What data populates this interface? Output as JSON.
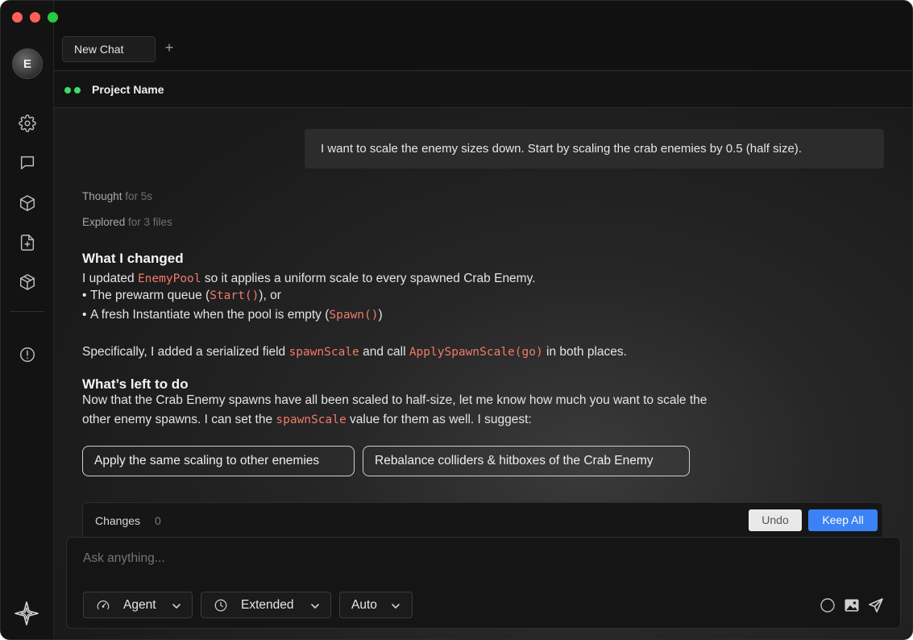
{
  "window": {
    "traffic_lights": [
      "close",
      "minimize",
      "maximize"
    ]
  },
  "sidebar": {
    "avatar_initial": "E",
    "items": [
      {
        "icon": "gear-icon"
      },
      {
        "icon": "chat-bubble-icon"
      },
      {
        "icon": "cube-icon"
      },
      {
        "icon": "file-plus-icon"
      },
      {
        "icon": "package-icon"
      },
      {
        "icon": "alert-circle-icon"
      }
    ],
    "logo_icon": "sparkle-star-icon"
  },
  "tabs": {
    "items": [
      {
        "label": "New Chat"
      }
    ],
    "add_label": "+"
  },
  "project": {
    "name": "Project Name",
    "status_color": "#3ddc6a"
  },
  "conversation": {
    "user_message": "I want to scale the enemy sizes down. Start by scaling the crab enemies by 0.5 (half size).",
    "thought": {
      "label": "Thought",
      "detail": "for 5s"
    },
    "explored": {
      "label": "Explored",
      "detail": "for 3 files"
    },
    "changed_heading": "What I changed",
    "changed_intro": {
      "pre": "I updated ",
      "code": "EnemyPool",
      "post": " so it applies a uniform scale to every spawned Crab Enemy."
    },
    "bullets": [
      {
        "pre": "The prewarm queue (",
        "code": "Start()",
        "post": "), or"
      },
      {
        "pre": "A fresh Instantiate when the pool is empty (",
        "code": "Spawn()",
        "post": ")"
      }
    ],
    "specific": {
      "pre": "Specifically, I added a serialized field ",
      "code1": "spawnScale",
      "mid": " and call ",
      "code2": "ApplySpawnScale(go)",
      "post": " in both places."
    },
    "left_heading": "What’s left to do",
    "left_line1": "Now that the Crab Enemy spawns have all been scaled to half-size, let me know how much you want to scale the",
    "left_line2": {
      "pre": "other enemy spawns. I can set the ",
      "code": "spawnScale",
      "post": " value for them as well. I suggest:"
    },
    "suggestions": [
      {
        "label": "Apply the same scaling to other enemies"
      },
      {
        "label": "Rebalance colliders & hitboxes of the Crab Enemy"
      }
    ]
  },
  "changes": {
    "label": "Changes",
    "count": "0",
    "undo_label": "Undo",
    "keep_label": "Keep All",
    "keep_color": "#3b82f6"
  },
  "composer": {
    "placeholder": "Ask anything...",
    "mode": {
      "label": "Agent",
      "icon": "gauge-icon"
    },
    "thinking": {
      "label": "Extended",
      "icon": "clock-icon"
    },
    "model": {
      "label": "Auto"
    },
    "tools": [
      "circle-icon",
      "image-icon",
      "send-icon"
    ]
  }
}
